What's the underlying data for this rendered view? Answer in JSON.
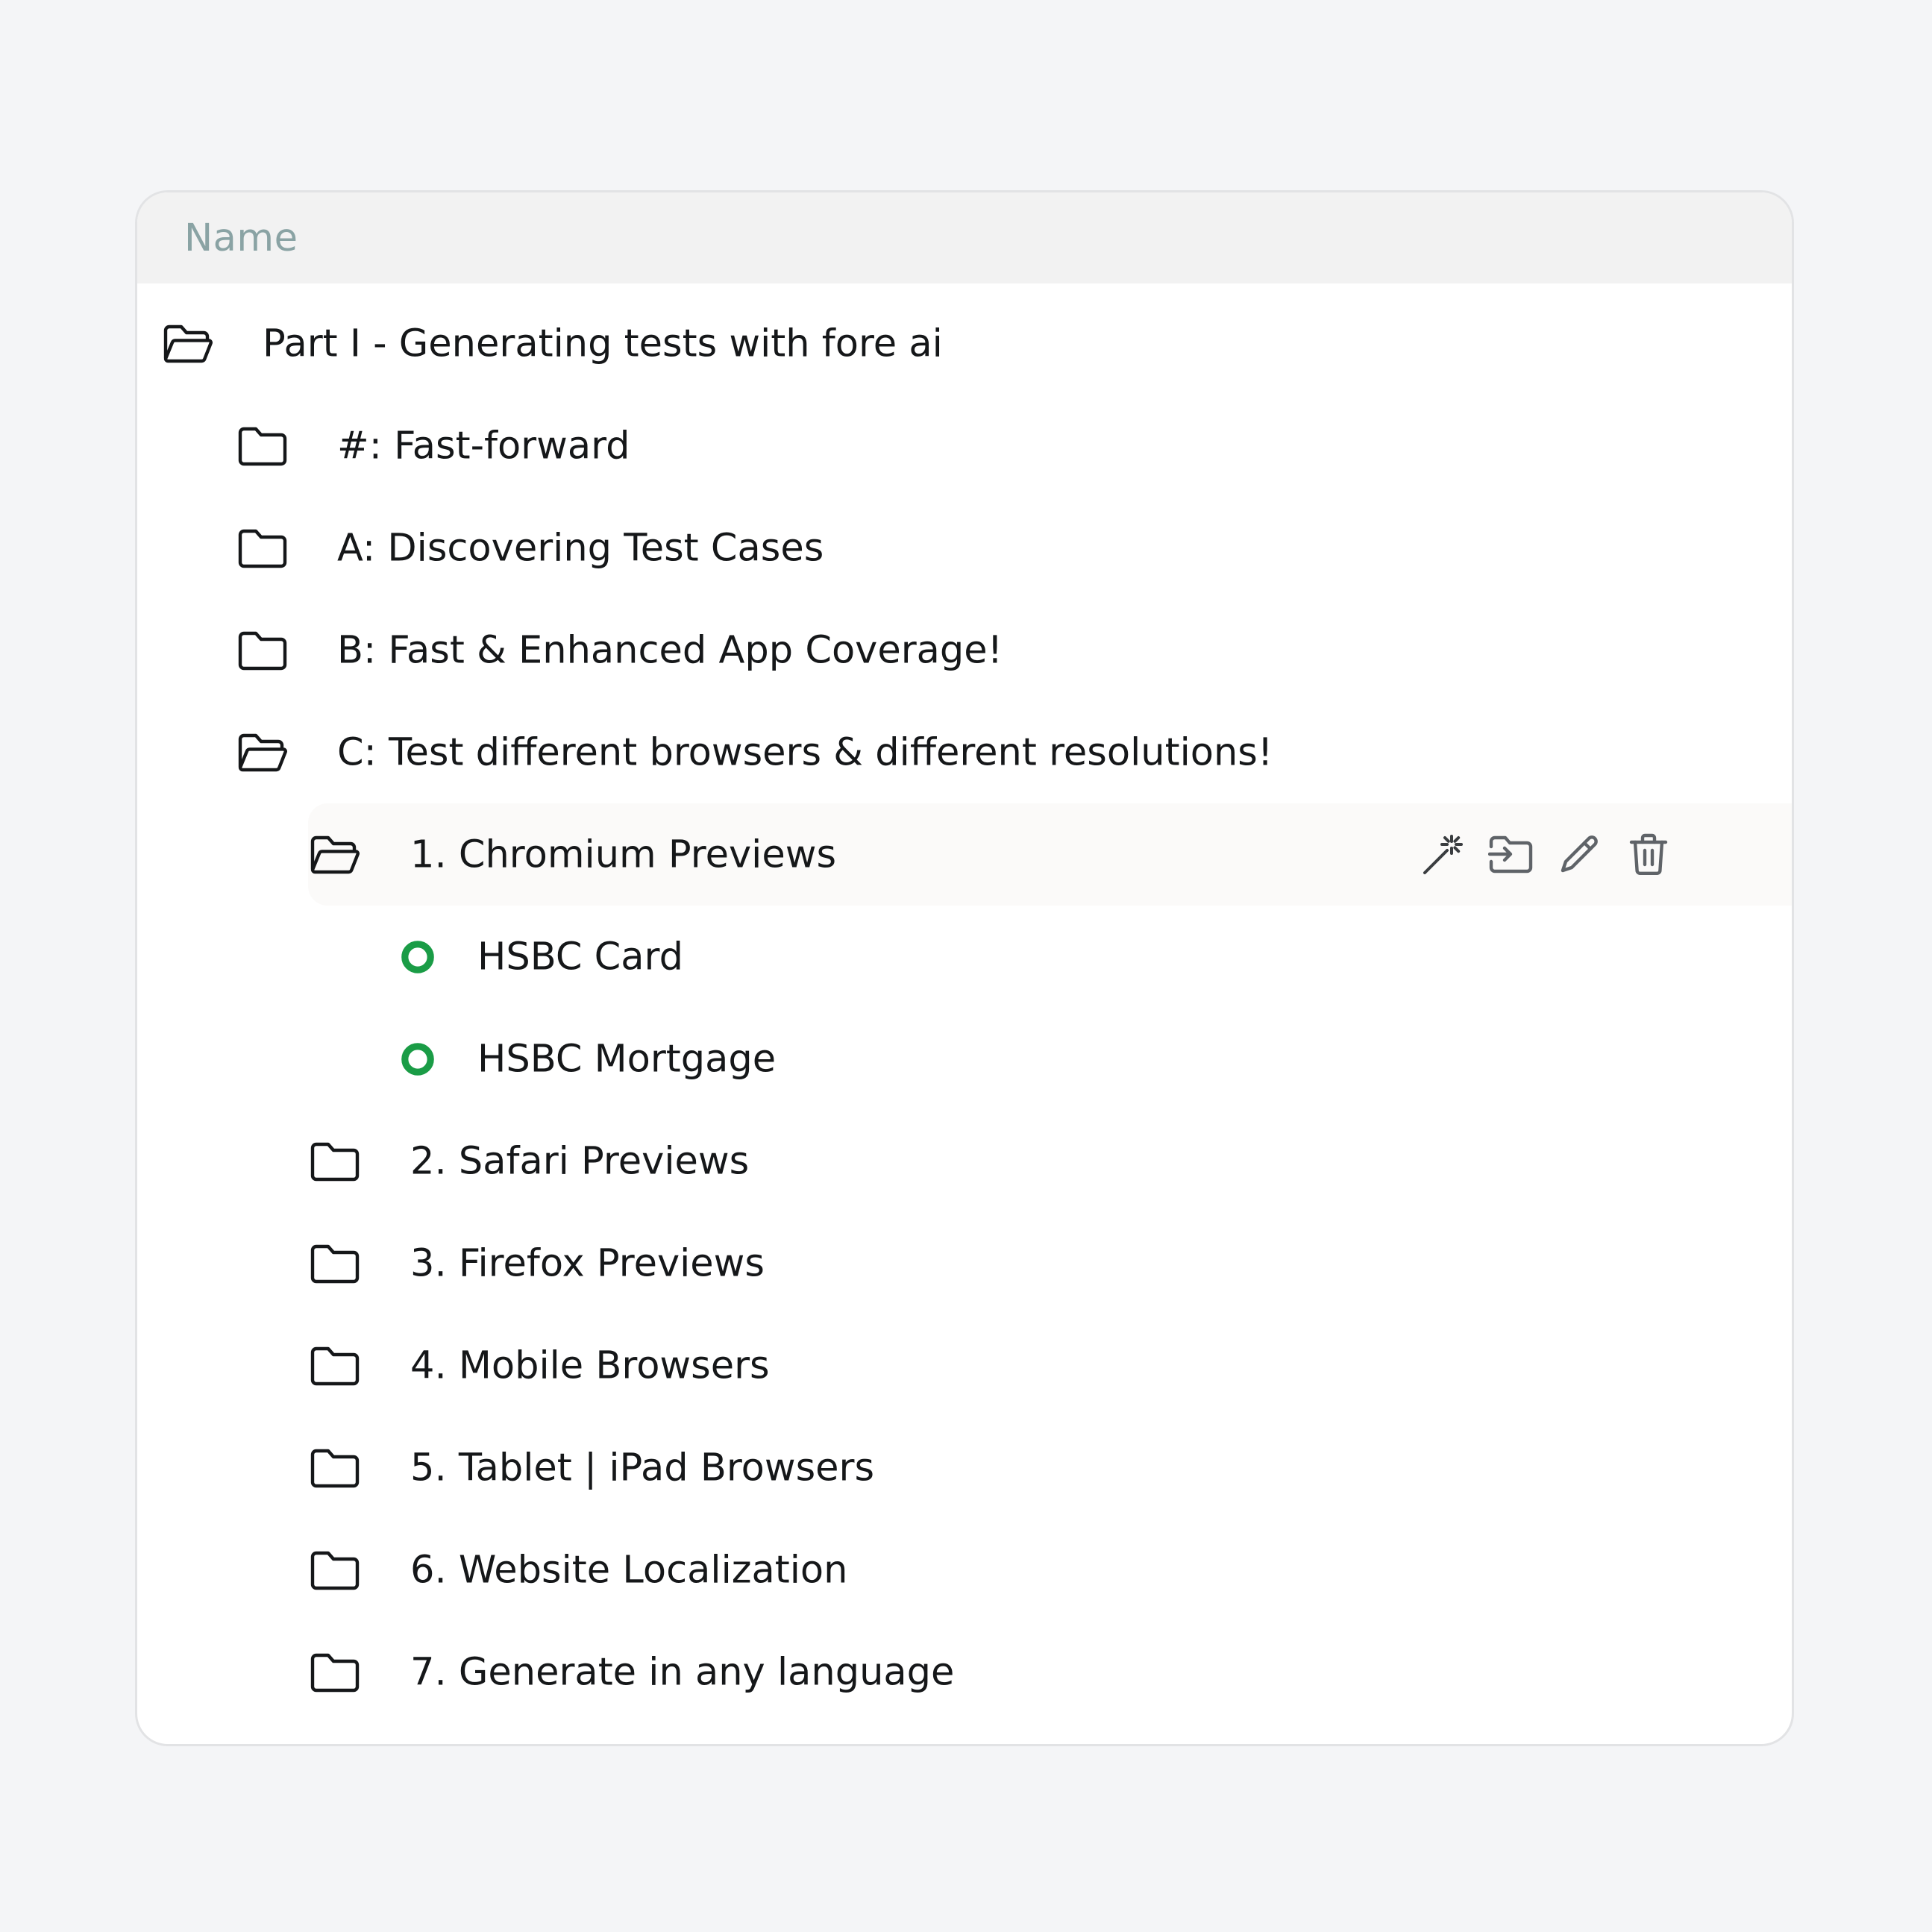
{
  "header": {
    "name_label": "Name"
  },
  "tree": [
    {
      "label": "Part I - Generating tests with fore ai",
      "type": "folder",
      "expanded": true,
      "level": 0
    },
    {
      "label": "#: Fast-forward",
      "type": "folder",
      "expanded": false,
      "level": 1
    },
    {
      "label": "A: Discovering Test Cases",
      "type": "folder",
      "expanded": false,
      "level": 1
    },
    {
      "label": "B: Fast & Enhanced App Coverage!",
      "type": "folder",
      "expanded": false,
      "level": 1
    },
    {
      "label": "C: Test different browsers & different resolutions!",
      "type": "folder",
      "expanded": true,
      "level": 1
    },
    {
      "label": "1. Chromium Previews",
      "type": "folder",
      "expanded": true,
      "level": 2,
      "selected": true
    },
    {
      "label": "HSBC Card",
      "type": "test",
      "status": "passed",
      "level": 3
    },
    {
      "label": "HSBC Mortgage",
      "type": "test",
      "status": "passed",
      "level": 3
    },
    {
      "label": "2. Safari Previews",
      "type": "folder",
      "expanded": false,
      "level": 2
    },
    {
      "label": "3. Firefox Previews",
      "type": "folder",
      "expanded": false,
      "level": 2
    },
    {
      "label": "4. Mobile Browsers",
      "type": "folder",
      "expanded": false,
      "level": 2
    },
    {
      "label": "5. Tablet | iPad Browsers",
      "type": "folder",
      "expanded": false,
      "level": 2
    },
    {
      "label": "6. Website Localization",
      "type": "folder",
      "expanded": false,
      "level": 2
    },
    {
      "label": "7. Generate in any language",
      "type": "folder",
      "expanded": false,
      "level": 2
    }
  ],
  "row_actions": [
    {
      "icon": "magic-wand-icon"
    },
    {
      "icon": "move-to-folder-icon"
    },
    {
      "icon": "pencil-icon"
    },
    {
      "icon": "trash-icon"
    }
  ],
  "colors": {
    "status_passed": "#1a9c46",
    "text": "#151719",
    "header_text": "#8aa3a4",
    "action_icon": "#5f6368"
  }
}
